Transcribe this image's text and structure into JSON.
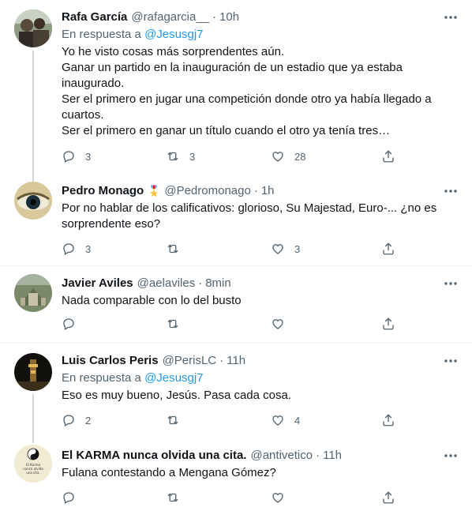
{
  "tweets": [
    {
      "name": "Rafa García",
      "handle": "@rafagarcia__",
      "time": "10h",
      "reply_prefix": "En respuesta a",
      "reply_to": "@Jesusgj7",
      "text": "Yo he visto cosas más sorprendentes aún.\nGanar un partido en la inauguración de un estadio que ya estaba inaugurado.\nSer el primero en jugar una competición donde otro ya había llegado a cuartos.\nSer el primero en ganar un título cuando el otro ya tenía tres…",
      "replies": "3",
      "retweets": "3",
      "likes": "28"
    },
    {
      "name": "Pedro Monago",
      "badge": "🎖️",
      "handle": "@Pedromonago",
      "time": "1h",
      "text": "Por no hablar de los calificativos: glorioso, Su Majestad, Euro-... ¿no es sorprendente eso?",
      "replies": "3",
      "retweets": "",
      "likes": "3"
    },
    {
      "name": "Javier Aviles",
      "handle": "@aelaviles",
      "time": "8min",
      "text": "Nada comparable con lo del busto",
      "replies": "",
      "retweets": "",
      "likes": ""
    },
    {
      "name": "Luis Carlos Peris",
      "handle": "@PerisLC",
      "time": "11h",
      "reply_prefix": "En respuesta a",
      "reply_to": "@Jesusgj7",
      "text": "Eso es muy bueno, Jesús. Pasa cada cosa.",
      "replies": "2",
      "retweets": "",
      "likes": "4"
    },
    {
      "name": "El KARMA nunca olvida una cita.",
      "handle": "@antivetico",
      "time": "11h",
      "avatar_text": "El Karma nunca olvida una cita.",
      "text": "Fulana contestando a Mengana Gómez?",
      "replies": "",
      "retweets": "",
      "likes": ""
    }
  ],
  "separator": "·",
  "icons": {
    "reply": "reply-icon",
    "retweet": "retweet-icon",
    "like": "like-icon",
    "share": "share-icon",
    "more": "more-icon"
  },
  "colors": {
    "text": "#0f1419",
    "secondary": "#536471",
    "link": "#1d9bf0",
    "divider": "#eff3f4",
    "thread_line": "#cfd9de"
  }
}
